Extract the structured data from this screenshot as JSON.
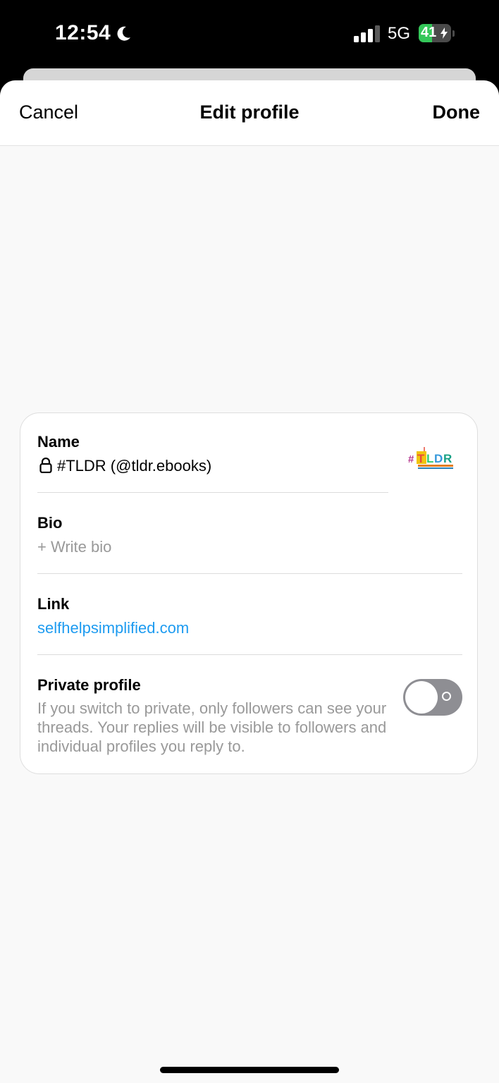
{
  "status_bar": {
    "time": "12:54",
    "dnd_icon": "moon-icon",
    "signal_icon": "cellular-signal-icon",
    "network": "5G",
    "battery_percent": "41",
    "battery_level": 0.41,
    "battery_icon": "battery-charging-icon"
  },
  "nav": {
    "cancel_label": "Cancel",
    "title": "Edit profile",
    "done_label": "Done"
  },
  "profile": {
    "name_label": "Name",
    "name_value": "#TLDR (@tldr.ebooks)",
    "lock_icon": "lock-icon",
    "avatar_logo_text": "#TLDR",
    "bio_label": "Bio",
    "bio_placeholder": "+ Write bio",
    "link_label": "Link",
    "link_value": "selfhelpsimplified.com",
    "private_label": "Private profile",
    "private_description": "If you switch to private, only followers can see your threads. Your replies will be visible to followers and individual profiles you reply to.",
    "private_enabled": false
  },
  "colors": {
    "link": "#1d9bf0",
    "toggle_off": "#8e8e93",
    "battery_green": "#34c759",
    "placeholder": "#999999"
  }
}
